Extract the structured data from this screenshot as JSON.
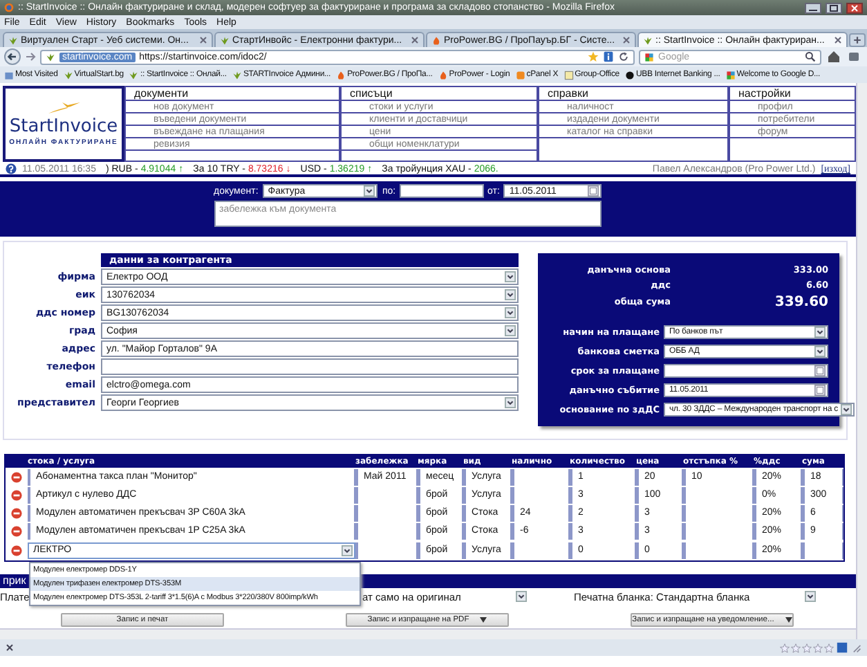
{
  "browser": {
    "title": ":: StartInvoice :: Онлайн фактуриране и склад, модерен софтуер за фактуриране и програма за складово стопанство - Mozilla Firefox",
    "menu": [
      "File",
      "Edit",
      "View",
      "History",
      "Bookmarks",
      "Tools",
      "Help"
    ],
    "tabs": [
      {
        "label": "Виртуален Старт - Уеб системи. Он...",
        "kind": "leaf",
        "selected": false
      },
      {
        "label": "СтартИнвойс - Електронни фактури...",
        "kind": "leaf",
        "selected": false
      },
      {
        "label": "ProPower.BG / ПроПауър.БГ - Систе...",
        "kind": "flame",
        "selected": false
      },
      {
        "label": ":: StartInvoice :: Онлайн фактуриран...",
        "kind": "leaf",
        "selected": true
      }
    ],
    "site_badge": "startinvoice.com",
    "url": "https://startinvoice.com/idoc2/",
    "search_placeholder": "Google",
    "bookmarks": [
      {
        "label": "Most Visited",
        "kind": "folder"
      },
      {
        "label": "VirtualStart.bg",
        "kind": "leaf"
      },
      {
        "label": ":: StartInvoice :: Онлай...",
        "kind": "leaf"
      },
      {
        "label": "STARTInvoice Админи...",
        "kind": "leaf"
      },
      {
        "label": "ProPower.BG / ПроПа...",
        "kind": "flame"
      },
      {
        "label": "ProPower - Login",
        "kind": "flame"
      },
      {
        "label": "cPanel X",
        "kind": "square"
      },
      {
        "label": "Group-Office",
        "kind": "grid"
      },
      {
        "label": "UBB Internet Banking ...",
        "kind": "circle"
      },
      {
        "label": "Welcome to Google D...",
        "kind": "google"
      }
    ]
  },
  "app": {
    "logo": {
      "name": "StartInvoice",
      "tagline": "ОНЛАЙН ФАКТУРИРАНЕ"
    },
    "menu": [
      {
        "title": "документи",
        "items": [
          "нов документ",
          "въведени документи",
          "въвеждане на плащания",
          "ревизия"
        ]
      },
      {
        "title": "списъци",
        "items": [
          "стоки и услуги",
          "клиенти и доставчици",
          "цени",
          "общи номенклатури"
        ]
      },
      {
        "title": "справки",
        "items": [
          "наличност",
          "издадени документи",
          "каталог на справки"
        ]
      },
      {
        "title": "настройки",
        "items": [
          "профил",
          "потребители",
          "форум"
        ]
      }
    ],
    "ticker": {
      "datetime": "11.05.2011 16:35",
      "rates": [
        {
          "label": ") RUB -",
          "value": "4.91044",
          "color": "#239a23",
          "arrow": "↑"
        },
        {
          "label": "За 10 TRY -",
          "value": "8.73216",
          "color": "#e0202a",
          "arrow": "↓"
        },
        {
          "label": "USD -",
          "value": "1.36219",
          "color": "#239a23",
          "arrow": "↑"
        },
        {
          "label": "За тройунция XAU -",
          "value": "2066.",
          "color": "#239a23"
        }
      ]
    },
    "user": "Павел Александров (Pro Power Ltd.)",
    "logout": "[изход]"
  },
  "document": {
    "type_label": "документ:",
    "type": "Фактура",
    "number_label": "по:",
    "date_label": "от:",
    "date": "11.05.2011",
    "note_placeholder": "забележка към документа"
  },
  "contractor": {
    "title": "данни за контрагента",
    "fields": [
      {
        "label": "фирма",
        "value": "Електро ООД",
        "kind": "select"
      },
      {
        "label": "еик",
        "value": "130762034",
        "kind": "select"
      },
      {
        "label": "ддс номер",
        "value": "BG130762034",
        "kind": "select"
      },
      {
        "label": "град",
        "value": "София",
        "kind": "select"
      },
      {
        "label": "адрес",
        "value": "ул. \"Майор Горталов\" 9А",
        "kind": "text"
      },
      {
        "label": "телефон",
        "kind": "text"
      },
      {
        "label": "email",
        "value": "elctro@omega.com",
        "kind": "text"
      },
      {
        "label": "представител",
        "value": "Георги Георгиев",
        "kind": "select"
      }
    ]
  },
  "totals": {
    "rows": [
      {
        "label": "данъчна основа",
        "value": "333.00",
        "kind": "plain"
      },
      {
        "label": "ддс",
        "value": "6.60",
        "kind": "plain"
      },
      {
        "label": "обща сума",
        "value": "339.60",
        "kind": "total"
      }
    ],
    "fields": [
      {
        "label": "начин на плащане",
        "value": "По банков път",
        "kind": "select"
      },
      {
        "label": "банкова сметка",
        "value": "ОББ АД",
        "kind": "select"
      },
      {
        "label": "срок за плащане",
        "kind": "date"
      },
      {
        "label": "данъчно събитие",
        "value": "11.05.2011",
        "kind": "date"
      },
      {
        "label": "основание по здДС",
        "value": "чл. 30 ЗДДС – Международен транспорт на с",
        "kind": "select"
      }
    ]
  },
  "table": {
    "columns": [
      "стока / услуга",
      "забележка",
      "мярка",
      "вид",
      "налично",
      "количество",
      "цена",
      "отстъпка %",
      "%ддс",
      "сума"
    ],
    "rows": [
      {
        "kind": "item",
        "product": "Абонаментна такса план \"Монитор\"",
        "note": "Май 2011",
        "unit": "месец",
        "type": "Услуга",
        "qty": "1",
        "price": "20",
        "discount": "10",
        "vat": "20%",
        "sum": "18"
      },
      {
        "kind": "item",
        "product": "Артикул с нулево ДДС",
        "unit": "брой",
        "type": "Услуга",
        "qty": "3",
        "price": "100",
        "vat": "0%",
        "sum": "300"
      },
      {
        "kind": "item",
        "product": "Модулен автоматичен прекъсвач 3P C60A 3kA",
        "unit": "брой",
        "type": "Стока",
        "stock": "24",
        "qty": "2",
        "price": "3",
        "vat": "20%",
        "sum": "6"
      },
      {
        "kind": "item",
        "product": "Модулен автоматичен прекъсвач 1P C25A 3kA",
        "unit": "брой",
        "type": "Стока",
        "stock": "-6",
        "qty": "3",
        "price": "3",
        "vat": "20%",
        "sum": "9"
      },
      {
        "kind": "editing",
        "product": "ЛЕКТРО",
        "unit": "брой",
        "type": "Услуга",
        "qty": "0",
        "price": "0",
        "vat": "20%",
        "suggestions": [
          {
            "text": "Модулен електромер DDS-1Y",
            "selected": false
          },
          {
            "text": "Модулен трифазен електромер DTS-353M",
            "selected": true
          },
          {
            "text": "Модулен електромер DTS-353L 2-tariff 3*1.5(6)A с Modbus 3*220/380V 800imp/kWh",
            "selected": false
          }
        ]
      }
    ]
  },
  "footer": {
    "bar_text": "прик",
    "options": [
      {
        "text": "Плате",
        "dropdown": false
      },
      {
        "text": "ат само на оригинал",
        "dropdown": true
      },
      {
        "text": "Печатна бланка: Стандартна бланка",
        "dropdown": true
      }
    ],
    "buttons": [
      {
        "label": "Запис и печат",
        "split": false
      },
      {
        "label": "Запис и изпращане на PDF",
        "split": true
      },
      {
        "label": "Запис и изпращане на уведомление...",
        "split": true
      }
    ]
  },
  "status_bar": {
    "stars": 0
  }
}
